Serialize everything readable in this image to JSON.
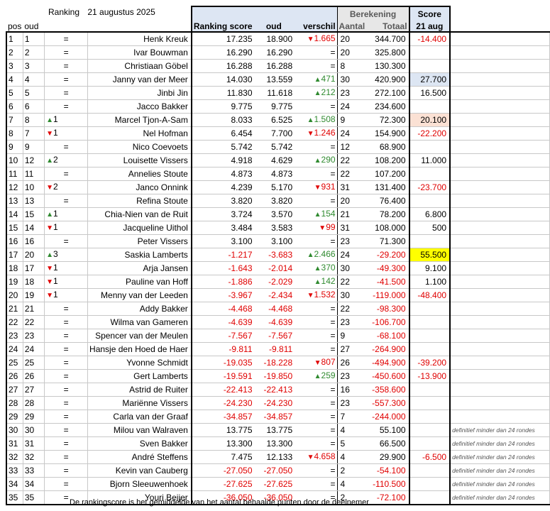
{
  "header": {
    "ranking_label": "Ranking",
    "date": "21 augustus 2025",
    "berekening": "Berekening",
    "score": "Score",
    "cols": {
      "pos": "pos",
      "oud": "oud",
      "ranking_score": "Ranking score",
      "oud_value": "oud",
      "verschil": "verschil",
      "aantal": "Aantal",
      "totaal": "Totaal",
      "score_date": "21 aug"
    }
  },
  "colors": {
    "blue_header": "#dde6f3",
    "highlight_blue": "#dde6f3",
    "highlight_pink": "#fbe1d4",
    "highlight_yellow": "#ffff00",
    "negative": "#e00000",
    "positive": "#2f8a2f"
  },
  "rows": [
    {
      "pos": "1",
      "oud": "1",
      "trend": "=",
      "dir": "eq",
      "name": "Henk Kreuk",
      "rs": "17.235",
      "oudv": "18.900",
      "vs": "1.665",
      "vdir": "down",
      "aantal": "20",
      "totaal": "344.700",
      "score": "-14.400",
      "hl": "",
      "note": ""
    },
    {
      "pos": "2",
      "oud": "2",
      "trend": "=",
      "dir": "eq",
      "name": "Ivar Bouwman",
      "rs": "16.290",
      "oudv": "16.290",
      "vs": "=",
      "vdir": "eq",
      "aantal": "20",
      "totaal": "325.800",
      "score": "",
      "hl": "",
      "note": ""
    },
    {
      "pos": "3",
      "oud": "3",
      "trend": "=",
      "dir": "eq",
      "name": "Christiaan Göbel",
      "rs": "16.288",
      "oudv": "16.288",
      "vs": "=",
      "vdir": "eq",
      "aantal": "8",
      "totaal": "130.300",
      "score": "",
      "hl": "",
      "note": ""
    },
    {
      "pos": "4",
      "oud": "4",
      "trend": "=",
      "dir": "eq",
      "name": "Janny van der Meer",
      "rs": "14.030",
      "oudv": "13.559",
      "vs": "471",
      "vdir": "up",
      "aantal": "30",
      "totaal": "420.900",
      "score": "27.700",
      "hl": "blue",
      "note": ""
    },
    {
      "pos": "5",
      "oud": "5",
      "trend": "=",
      "dir": "eq",
      "name": "Jinbi Jin",
      "rs": "11.830",
      "oudv": "11.618",
      "vs": "212",
      "vdir": "up",
      "aantal": "23",
      "totaal": "272.100",
      "score": "16.500",
      "hl": "",
      "note": ""
    },
    {
      "pos": "6",
      "oud": "6",
      "trend": "=",
      "dir": "eq",
      "name": "Jacco Bakker",
      "rs": "9.775",
      "oudv": "9.775",
      "vs": "=",
      "vdir": "eq",
      "aantal": "24",
      "totaal": "234.600",
      "score": "",
      "hl": "",
      "note": ""
    },
    {
      "pos": "7",
      "oud": "8",
      "trend": "1",
      "dir": "up",
      "name": "Marcel Tjon-A-Sam",
      "rs": "8.033",
      "oudv": "6.525",
      "vs": "1.508",
      "vdir": "up",
      "aantal": "9",
      "totaal": "72.300",
      "score": "20.100",
      "hl": "pink",
      "note": ""
    },
    {
      "pos": "8",
      "oud": "7",
      "trend": "1",
      "dir": "down",
      "name": "Nel Hofman",
      "rs": "6.454",
      "oudv": "7.700",
      "vs": "1.246",
      "vdir": "down",
      "aantal": "24",
      "totaal": "154.900",
      "score": "-22.200",
      "hl": "",
      "note": ""
    },
    {
      "pos": "9",
      "oud": "9",
      "trend": "=",
      "dir": "eq",
      "name": "Nico Coevoets",
      "rs": "5.742",
      "oudv": "5.742",
      "vs": "=",
      "vdir": "eq",
      "aantal": "12",
      "totaal": "68.900",
      "score": "",
      "hl": "",
      "note": ""
    },
    {
      "pos": "10",
      "oud": "12",
      "trend": "2",
      "dir": "up",
      "name": "Louisette Vissers",
      "rs": "4.918",
      "oudv": "4.629",
      "vs": "290",
      "vdir": "up",
      "aantal": "22",
      "totaal": "108.200",
      "score": "11.000",
      "hl": "",
      "note": ""
    },
    {
      "pos": "11",
      "oud": "11",
      "trend": "=",
      "dir": "eq",
      "name": "Annelies Stoute",
      "rs": "4.873",
      "oudv": "4.873",
      "vs": "=",
      "vdir": "eq",
      "aantal": "22",
      "totaal": "107.200",
      "score": "",
      "hl": "",
      "note": ""
    },
    {
      "pos": "12",
      "oud": "10",
      "trend": "2",
      "dir": "down",
      "name": "Janco Onnink",
      "rs": "4.239",
      "oudv": "5.170",
      "vs": "931",
      "vdir": "down",
      "aantal": "31",
      "totaal": "131.400",
      "score": "-23.700",
      "hl": "",
      "note": ""
    },
    {
      "pos": "13",
      "oud": "13",
      "trend": "=",
      "dir": "eq",
      "name": "Refina Stoute",
      "rs": "3.820",
      "oudv": "3.820",
      "vs": "=",
      "vdir": "eq",
      "aantal": "20",
      "totaal": "76.400",
      "score": "",
      "hl": "",
      "note": ""
    },
    {
      "pos": "14",
      "oud": "15",
      "trend": "1",
      "dir": "up",
      "name": "Chia-Nien van de Ruit",
      "rs": "3.724",
      "oudv": "3.570",
      "vs": "154",
      "vdir": "up",
      "aantal": "21",
      "totaal": "78.200",
      "score": "6.800",
      "hl": "",
      "note": ""
    },
    {
      "pos": "15",
      "oud": "14",
      "trend": "1",
      "dir": "down",
      "name": "Jacqueline Uithol",
      "rs": "3.484",
      "oudv": "3.583",
      "vs": "99",
      "vdir": "down",
      "aantal": "31",
      "totaal": "108.000",
      "score": "500",
      "hl": "",
      "note": ""
    },
    {
      "pos": "16",
      "oud": "16",
      "trend": "=",
      "dir": "eq",
      "name": "Peter Vissers",
      "rs": "3.100",
      "oudv": "3.100",
      "vs": "=",
      "vdir": "eq",
      "aantal": "23",
      "totaal": "71.300",
      "score": "",
      "hl": "",
      "note": ""
    },
    {
      "pos": "17",
      "oud": "20",
      "trend": "3",
      "dir": "up",
      "name": "Saskia Lamberts",
      "rs": "-1.217",
      "oudv": "-3.683",
      "vs": "2.466",
      "vdir": "up",
      "aantal": "24",
      "totaal": "-29.200",
      "score": "55.500",
      "hl": "yellow",
      "note": ""
    },
    {
      "pos": "18",
      "oud": "17",
      "trend": "1",
      "dir": "down",
      "name": "Arja Jansen",
      "rs": "-1.643",
      "oudv": "-2.014",
      "vs": "370",
      "vdir": "up",
      "aantal": "30",
      "totaal": "-49.300",
      "score": "9.100",
      "hl": "",
      "note": ""
    },
    {
      "pos": "19",
      "oud": "18",
      "trend": "1",
      "dir": "down",
      "name": "Pauline van Hoff",
      "rs": "-1.886",
      "oudv": "-2.029",
      "vs": "142",
      "vdir": "up",
      "aantal": "22",
      "totaal": "-41.500",
      "score": "1.100",
      "hl": "",
      "note": ""
    },
    {
      "pos": "20",
      "oud": "19",
      "trend": "1",
      "dir": "down",
      "name": "Menny van der Leeden",
      "rs": "-3.967",
      "oudv": "-2.434",
      "vs": "1.532",
      "vdir": "down",
      "aantal": "30",
      "totaal": "-119.000",
      "score": "-48.400",
      "hl": "",
      "note": ""
    },
    {
      "pos": "21",
      "oud": "21",
      "trend": "=",
      "dir": "eq",
      "name": "Addy Bakker",
      "rs": "-4.468",
      "oudv": "-4.468",
      "vs": "=",
      "vdir": "eq",
      "aantal": "22",
      "totaal": "-98.300",
      "score": "",
      "hl": "",
      "note": ""
    },
    {
      "pos": "22",
      "oud": "22",
      "trend": "=",
      "dir": "eq",
      "name": "Wilma van Gameren",
      "rs": "-4.639",
      "oudv": "-4.639",
      "vs": "=",
      "vdir": "eq",
      "aantal": "23",
      "totaal": "-106.700",
      "score": "",
      "hl": "",
      "note": ""
    },
    {
      "pos": "23",
      "oud": "23",
      "trend": "=",
      "dir": "eq",
      "name": "Spencer van der Meulen",
      "rs": "-7.567",
      "oudv": "-7.567",
      "vs": "=",
      "vdir": "eq",
      "aantal": "9",
      "totaal": "-68.100",
      "score": "",
      "hl": "",
      "note": ""
    },
    {
      "pos": "24",
      "oud": "24",
      "trend": "=",
      "dir": "eq",
      "name": "Hansje den Hoed de Haer",
      "rs": "-9.811",
      "oudv": "-9.811",
      "vs": "=",
      "vdir": "eq",
      "aantal": "27",
      "totaal": "-264.900",
      "score": "",
      "hl": "",
      "note": ""
    },
    {
      "pos": "25",
      "oud": "25",
      "trend": "=",
      "dir": "eq",
      "name": "Yvonne Schmidt",
      "rs": "-19.035",
      "oudv": "-18.228",
      "vs": "807",
      "vdir": "down",
      "aantal": "26",
      "totaal": "-494.900",
      "score": "-39.200",
      "hl": "",
      "note": ""
    },
    {
      "pos": "26",
      "oud": "26",
      "trend": "=",
      "dir": "eq",
      "name": "Gert Lamberts",
      "rs": "-19.591",
      "oudv": "-19.850",
      "vs": "259",
      "vdir": "up",
      "aantal": "23",
      "totaal": "-450.600",
      "score": "-13.900",
      "hl": "",
      "note": ""
    },
    {
      "pos": "27",
      "oud": "27",
      "trend": "=",
      "dir": "eq",
      "name": "Astrid de Ruiter",
      "rs": "-22.413",
      "oudv": "-22.413",
      "vs": "=",
      "vdir": "eq",
      "aantal": "16",
      "totaal": "-358.600",
      "score": "",
      "hl": "",
      "note": ""
    },
    {
      "pos": "28",
      "oud": "28",
      "trend": "=",
      "dir": "eq",
      "name": "Mariënne Vissers",
      "rs": "-24.230",
      "oudv": "-24.230",
      "vs": "=",
      "vdir": "eq",
      "aantal": "23",
      "totaal": "-557.300",
      "score": "",
      "hl": "",
      "note": ""
    },
    {
      "pos": "29",
      "oud": "29",
      "trend": "=",
      "dir": "eq",
      "name": "Carla van der Graaf",
      "rs": "-34.857",
      "oudv": "-34.857",
      "vs": "=",
      "vdir": "eq",
      "aantal": "7",
      "totaal": "-244.000",
      "score": "",
      "hl": "",
      "note": ""
    },
    {
      "pos": "30",
      "oud": "30",
      "trend": "=",
      "dir": "eq",
      "name": "Milou van Walraven",
      "rs": "13.775",
      "oudv": "13.775",
      "vs": "=",
      "vdir": "eq",
      "aantal": "4",
      "totaal": "55.100",
      "score": "",
      "hl": "",
      "note": "definitief minder dan 24 rondes"
    },
    {
      "pos": "31",
      "oud": "31",
      "trend": "=",
      "dir": "eq",
      "name": "Sven Bakker",
      "rs": "13.300",
      "oudv": "13.300",
      "vs": "=",
      "vdir": "eq",
      "aantal": "5",
      "totaal": "66.500",
      "score": "",
      "hl": "",
      "note": "definitief minder dan 24 rondes"
    },
    {
      "pos": "32",
      "oud": "32",
      "trend": "=",
      "dir": "eq",
      "name": "André Steffens",
      "rs": "7.475",
      "oudv": "12.133",
      "vs": "4.658",
      "vdir": "down",
      "aantal": "4",
      "totaal": "29.900",
      "score": "-6.500",
      "hl": "",
      "note": "definitief minder dan 24 rondes"
    },
    {
      "pos": "33",
      "oud": "33",
      "trend": "=",
      "dir": "eq",
      "name": "Kevin van Cauberg",
      "rs": "-27.050",
      "oudv": "-27.050",
      "vs": "=",
      "vdir": "eq",
      "aantal": "2",
      "totaal": "-54.100",
      "score": "",
      "hl": "",
      "note": "definitief minder dan 24 rondes"
    },
    {
      "pos": "34",
      "oud": "34",
      "trend": "=",
      "dir": "eq",
      "name": "Bjorn Sleeuwenhoek",
      "rs": "-27.625",
      "oudv": "-27.625",
      "vs": "=",
      "vdir": "eq",
      "aantal": "4",
      "totaal": "-110.500",
      "score": "",
      "hl": "",
      "note": "definitief minder dan 24 rondes"
    },
    {
      "pos": "35",
      "oud": "35",
      "trend": "=",
      "dir": "eq",
      "name": "Youri Beijer",
      "rs": "-36.050",
      "oudv": "-36.050",
      "vs": "=",
      "vdir": "eq",
      "aantal": "2",
      "totaal": "-72.100",
      "score": "",
      "hl": "",
      "note": "definitief minder dan 24 rondes"
    }
  ],
  "footer": "De rankingscore is het gemiddelde van het aantal behaalde punten door de deelnemer"
}
